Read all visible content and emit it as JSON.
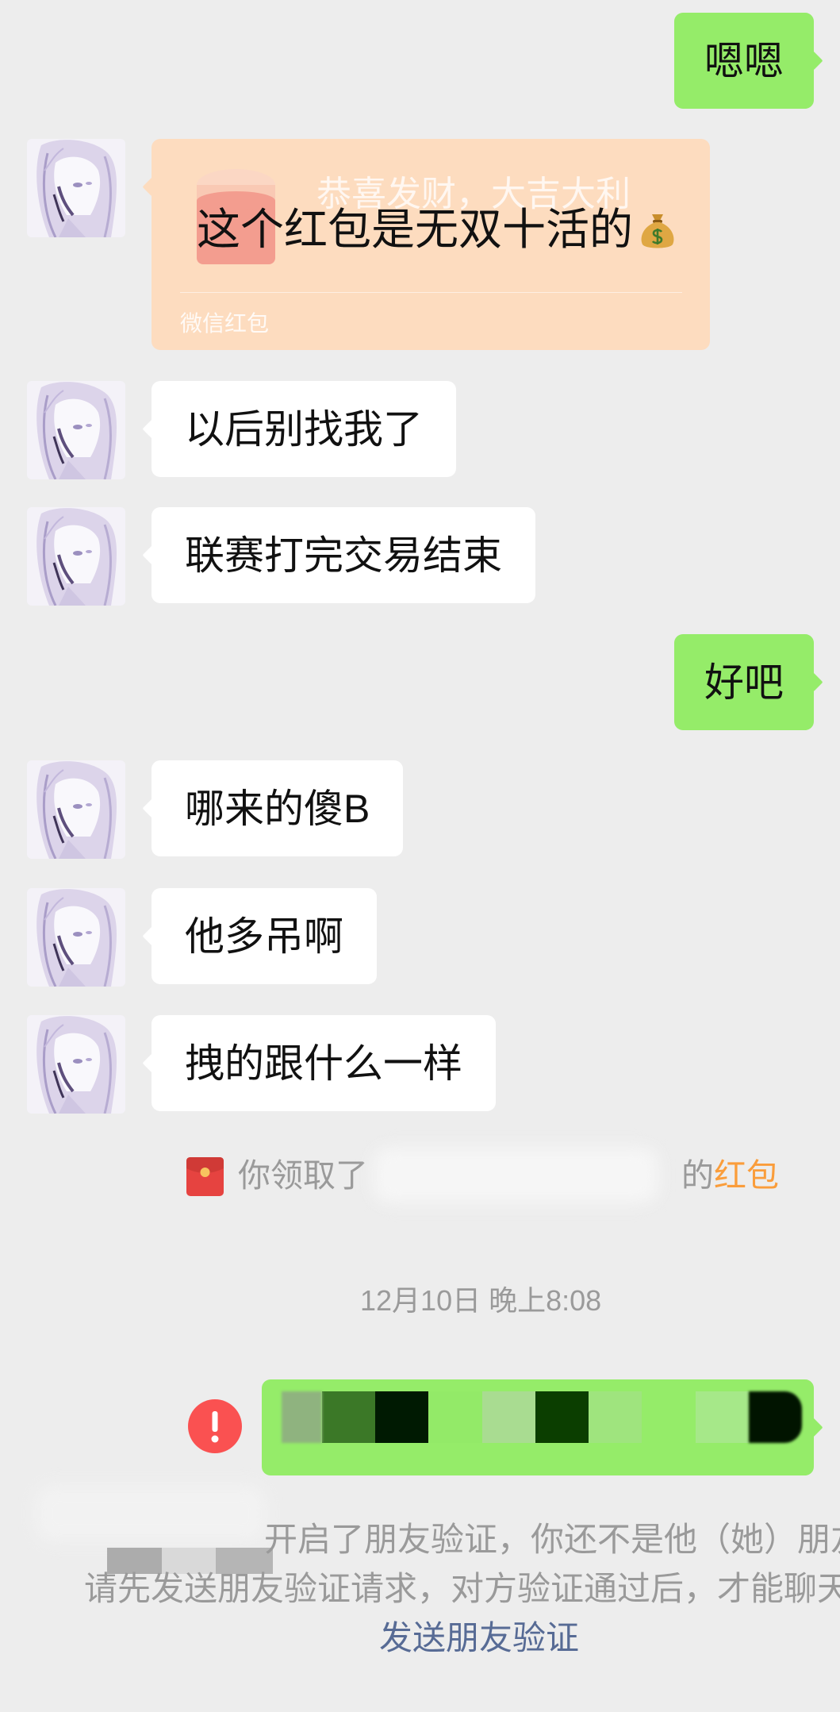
{
  "theme": {
    "background": "#ededed",
    "self_bubble": "#95ec69",
    "other_bubble": "#ffffff",
    "link": "#576b95",
    "packet_orange": "#fa9d3b",
    "error_red": "#fa5151",
    "system_text": "#9a9a9a",
    "opened_packet": "#fddcbf"
  },
  "chat": {
    "avatar_icon": "anime-avatar",
    "messages": [
      {
        "text": "嗯嗯"
      },
      {
        "text": "以后别找我了"
      },
      {
        "text": "联赛打完交易结束"
      },
      {
        "text": "好吧"
      },
      {
        "text": "哪来的傻B"
      },
      {
        "text": "他多吊啊"
      },
      {
        "text": "拽的跟什么一样"
      }
    ],
    "red_packet": {
      "icon": "red-envelope-icon",
      "greeting": "恭喜发财，大吉大利",
      "overlay_text": "这个红包是无双十活的",
      "overlay_icon": "money-bag-icon",
      "footer": "微信红包"
    },
    "packet_notice": {
      "icon": "red-packet-icon",
      "prefix": "你领取了",
      "suffix": "的",
      "packet_word": "红包"
    },
    "timestamp": "12月10日 晚上8:08",
    "failed_message": {
      "status_icon": "error-icon",
      "mosaic_colors": [
        "#8fb37f",
        "#3b7827",
        "#001a02",
        "#93ea68",
        "#a9dc91",
        "#0b3e00",
        "#9fe47e",
        "#95ec69",
        "#a6e889",
        "#011400"
      ]
    },
    "verification_notice": {
      "line1": "开启了朋友验证，你还不是他（她）朋友",
      "line2": "请先发送朋友验证请求，对方验证通过后，才能聊天",
      "action": "发送朋友验证"
    }
  }
}
